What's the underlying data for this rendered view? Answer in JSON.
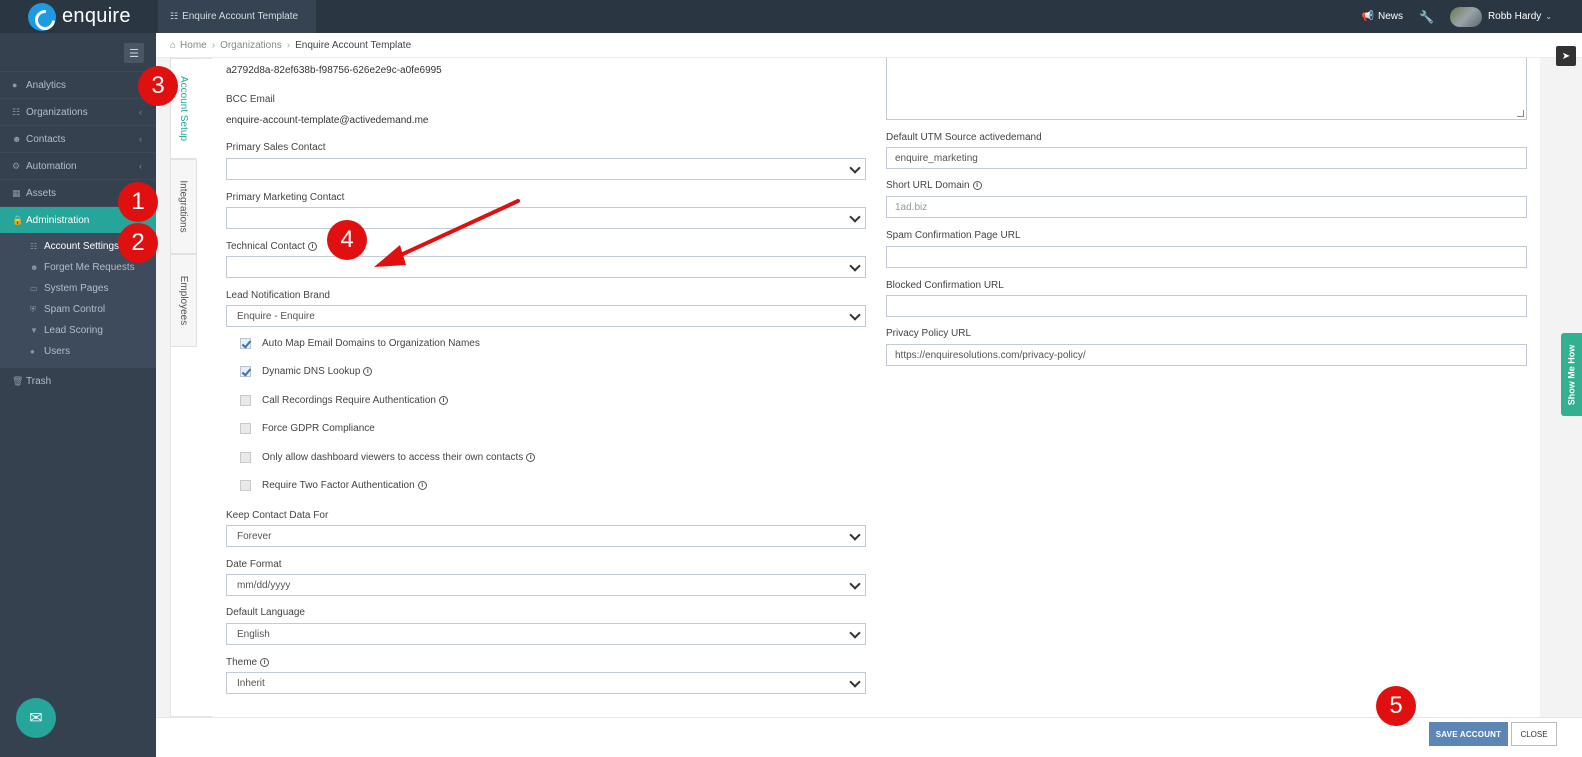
{
  "app": {
    "brand": "enquire",
    "tab": "Enquire Account Template",
    "news": "News",
    "user": "Robb Hardy"
  },
  "breadcrumb": [
    "Home",
    "Organizations",
    "Enquire Account Template"
  ],
  "sidebar": {
    "items": [
      {
        "label": "Analytics",
        "icon": "analytics-icon"
      },
      {
        "label": "Organizations",
        "icon": "sitemap-icon"
      },
      {
        "label": "Contacts",
        "icon": "users-icon"
      },
      {
        "label": "Automation",
        "icon": "cogs-icon"
      },
      {
        "label": "Assets",
        "icon": "grid-icon"
      },
      {
        "label": "Administration",
        "icon": "lock-icon"
      }
    ],
    "sub_items": [
      {
        "label": "Account Settings"
      },
      {
        "label": "Forget Me Requests"
      },
      {
        "label": "System Pages"
      },
      {
        "label": "Spam Control"
      },
      {
        "label": "Lead Scoring"
      },
      {
        "label": "Users"
      }
    ],
    "trash": "Trash"
  },
  "tabs": [
    "Account Setup",
    "Integrations",
    "Employees"
  ],
  "form_left": {
    "account_id": "a2792d8a-82ef638b-f98756-626e2e9c-a0fe6995",
    "bcc_label": "BCC Email",
    "bcc_value": "enquire-account-template@activedemand.me",
    "primary_sales_label": "Primary Sales Contact",
    "primary_sales_value": "",
    "primary_marketing_label": "Primary Marketing Contact",
    "primary_marketing_value": "",
    "technical_label": "Technical Contact",
    "technical_value": "",
    "lead_brand_label": "Lead Notification Brand",
    "lead_brand_value": "Enquire - Enquire",
    "checkboxes": [
      {
        "label": "Auto Map Email Domains to Organization Names",
        "checked": true
      },
      {
        "label": "Dynamic DNS Lookup",
        "checked": true
      },
      {
        "label": "Call Recordings Require Authentication",
        "checked": false
      },
      {
        "label": "Force GDPR Compliance",
        "checked": false
      },
      {
        "label": "Only allow dashboard viewers to access their own contacts",
        "checked": false
      },
      {
        "label": "Require Two Factor Authentication",
        "checked": false
      }
    ],
    "keep_label": "Keep Contact Data For",
    "keep_value": "Forever",
    "date_label": "Date Format",
    "date_value": "mm/dd/yyyy",
    "lang_label": "Default Language",
    "lang_value": "English",
    "theme_label": "Theme",
    "theme_value": "Inherit"
  },
  "form_right": {
    "utm_label": "Default UTM Source activedemand",
    "utm_value": "enquire_marketing",
    "short_url_label": "Short URL Domain",
    "short_url_placeholder": "1ad.biz",
    "spam_label": "Spam Confirmation Page URL",
    "spam_value": "",
    "blocked_label": "Blocked Confirmation URL",
    "blocked_value": "",
    "privacy_label": "Privacy Policy URL",
    "privacy_value": "https://enquiresolutions.com/privacy-policy/"
  },
  "show_me_how": "Show Me How",
  "buttons": {
    "save": "SAVE ACCOUNT",
    "close": "CLOSE"
  },
  "annotations": [
    "1",
    "2",
    "3",
    "4",
    "5"
  ],
  "colors": {
    "topbar": "#2b3643",
    "sidebar": "#364150",
    "accent": "#26a69a",
    "save_button": "#5b86b6",
    "annotation": "#e01010"
  }
}
